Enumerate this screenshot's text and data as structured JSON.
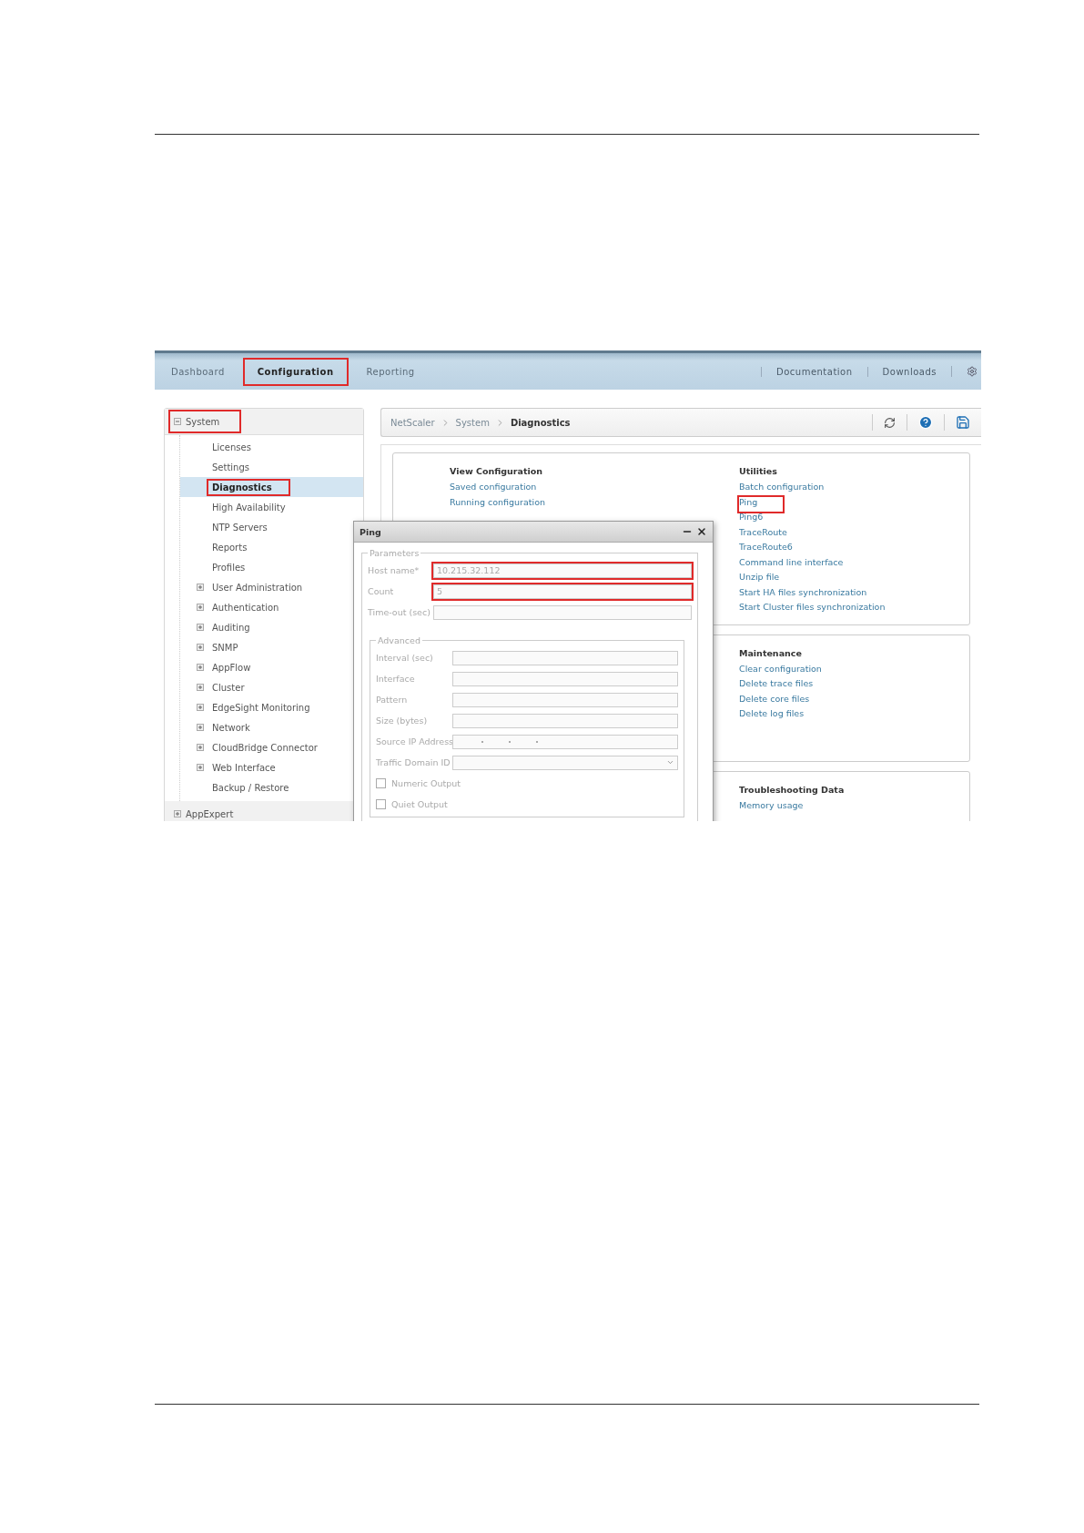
{
  "nav": {
    "tabs": [
      {
        "label": "Dashboard",
        "selected": false,
        "highlighted": false
      },
      {
        "label": "Configuration",
        "selected": true,
        "highlighted": true
      },
      {
        "label": "Reporting",
        "selected": false,
        "highlighted": false
      }
    ],
    "links": [
      "Documentation",
      "Downloads"
    ]
  },
  "sidebar": {
    "items": [
      {
        "label": "System",
        "expanded": true,
        "highlighted": true,
        "children": [
          {
            "label": "Licenses",
            "expandable": false,
            "selected": false,
            "highlighted": false
          },
          {
            "label": "Settings",
            "expandable": false,
            "selected": false,
            "highlighted": false
          },
          {
            "label": "Diagnostics",
            "expandable": false,
            "selected": true,
            "highlighted": true
          },
          {
            "label": "High Availability",
            "expandable": false,
            "selected": false,
            "highlighted": false
          },
          {
            "label": "NTP Servers",
            "expandable": false,
            "selected": false,
            "highlighted": false
          },
          {
            "label": "Reports",
            "expandable": false,
            "selected": false,
            "highlighted": false
          },
          {
            "label": "Profiles",
            "expandable": false,
            "selected": false,
            "highlighted": false
          },
          {
            "label": "User Administration",
            "expandable": true,
            "selected": false,
            "highlighted": false
          },
          {
            "label": "Authentication",
            "expandable": true,
            "selected": false,
            "highlighted": false
          },
          {
            "label": "Auditing",
            "expandable": true,
            "selected": false,
            "highlighted": false
          },
          {
            "label": "SNMP",
            "expandable": true,
            "selected": false,
            "highlighted": false
          },
          {
            "label": "AppFlow",
            "expandable": true,
            "selected": false,
            "highlighted": false
          },
          {
            "label": "Cluster",
            "expandable": true,
            "selected": false,
            "highlighted": false
          },
          {
            "label": "EdgeSight Monitoring",
            "expandable": true,
            "selected": false,
            "highlighted": false
          },
          {
            "label": "Network",
            "expandable": true,
            "selected": false,
            "highlighted": false
          },
          {
            "label": "CloudBridge Connector",
            "expandable": true,
            "selected": false,
            "highlighted": false
          },
          {
            "label": "Web Interface",
            "expandable": true,
            "selected": false,
            "highlighted": false
          },
          {
            "label": "Backup / Restore",
            "expandable": false,
            "selected": false,
            "highlighted": false
          }
        ]
      },
      {
        "label": "AppExpert",
        "expanded": false,
        "highlighted": false
      }
    ]
  },
  "breadcrumb": [
    "NetScaler",
    "System",
    "Diagnostics"
  ],
  "panels": [
    {
      "left": {
        "title": "View Configuration",
        "links": [
          {
            "label": "Saved configuration",
            "highlighted": false
          },
          {
            "label": "Running configuration",
            "highlighted": false
          }
        ]
      },
      "right": {
        "title": "Utilities",
        "links": [
          {
            "label": "Batch configuration",
            "highlighted": false
          },
          {
            "label": "Ping",
            "highlighted": true
          },
          {
            "label": "Ping6",
            "highlighted": false
          },
          {
            "label": "TraceRoute",
            "highlighted": false
          },
          {
            "label": "TraceRoute6",
            "highlighted": false
          },
          {
            "label": "Command line interface",
            "highlighted": false
          },
          {
            "label": "Unzip file",
            "highlighted": false
          },
          {
            "label": "Start HA files synchronization",
            "highlighted": false
          },
          {
            "label": "Start Cluster files synchronization",
            "highlighted": false
          }
        ]
      }
    },
    {
      "right": {
        "title": "Maintenance",
        "links": [
          {
            "label": "Clear configuration",
            "highlighted": false
          },
          {
            "label": "Delete trace files",
            "highlighted": false
          },
          {
            "label": "Delete core files",
            "highlighted": false
          },
          {
            "label": "Delete log files",
            "highlighted": false
          }
        ]
      }
    },
    {
      "right": {
        "title": "Troubleshooting Data",
        "links": [
          {
            "label": "Memory usage",
            "highlighted": false
          }
        ]
      }
    }
  ],
  "dialog": {
    "title": "Ping",
    "groups": [
      {
        "legend": "Parameters",
        "fields": [
          {
            "kind": "text",
            "label": "Host name*",
            "value": "10.215.32.112",
            "highlighted": true
          },
          {
            "kind": "text",
            "label": "Count",
            "value": "5",
            "highlighted": true
          },
          {
            "kind": "text",
            "label": "Time-out (sec)",
            "highlighted": false
          }
        ]
      },
      {
        "legend": "Advanced",
        "fields": [
          {
            "kind": "text",
            "label": "Interval (sec)",
            "highlighted": false
          },
          {
            "kind": "text",
            "label": "Interface",
            "highlighted": false
          },
          {
            "kind": "text",
            "label": "Pattern",
            "highlighted": false
          },
          {
            "kind": "text",
            "label": "Size (bytes)",
            "highlighted": false
          },
          {
            "kind": "ip",
            "label": "Source IP Address",
            "highlighted": false
          },
          {
            "kind": "select",
            "label": "Traffic Domain ID",
            "highlighted": false
          },
          {
            "kind": "checkbox",
            "label": "Numeric Output",
            "checked": false
          },
          {
            "kind": "checkbox",
            "label": "Quiet Output",
            "checked": false
          }
        ]
      }
    ]
  }
}
